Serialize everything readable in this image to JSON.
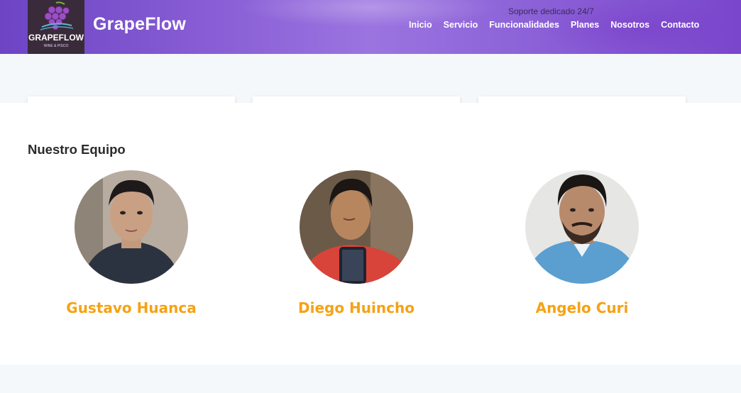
{
  "header": {
    "brand": "GrapeFlow",
    "logo_text": "GRAPEFLOW",
    "logo_subtext": "WINE & PISCO",
    "support_text": "Soporte dedicado 24/7",
    "nav": [
      "Inicio",
      "Servicio",
      "Funcionalidades",
      "Planes",
      "Nosotros",
      "Contacto"
    ]
  },
  "team": {
    "title": "Nuestro Equipo",
    "members": [
      {
        "name": "Gustavo Huanca"
      },
      {
        "name": "Diego Huincho"
      },
      {
        "name": "Angelo Curi"
      }
    ]
  },
  "colors": {
    "header_purple": "#8a5fd6",
    "member_name": "#f5a214",
    "section_bg": "#f5f8fb"
  },
  "icons": {
    "logo": "grape-logo-icon"
  }
}
